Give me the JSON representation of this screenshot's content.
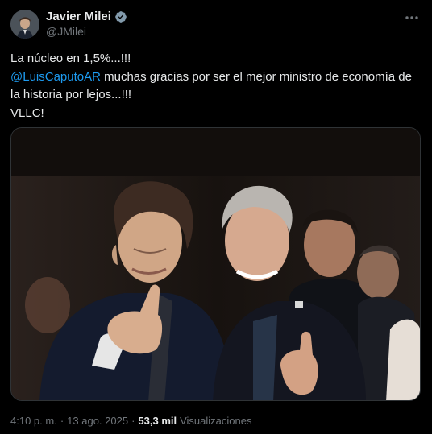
{
  "author": {
    "display_name": "Javier Milei",
    "handle": "@JMilei",
    "verified_icon": "verified-badge-icon"
  },
  "more_icon": "more-options-icon",
  "tweet": {
    "line1": "La núcleo en 1,5%...!!!",
    "mention": "@LuisCaputoAR",
    "line2_rest": " muchas gracias por ser el mejor ministro de economía de la historia por lejos...!!!",
    "line3": "VLLC!"
  },
  "meta": {
    "time": "4:10 p. m.",
    "separator1": "·",
    "date": "13 ago. 2025",
    "separator2": "·",
    "views_count": "53,3 mil",
    "views_label": "Visualizaciones"
  },
  "colors": {
    "background": "#000000",
    "text": "#e7e9ea",
    "secondary": "#71767b",
    "link": "#1d9bf0",
    "border": "#2f3336"
  }
}
